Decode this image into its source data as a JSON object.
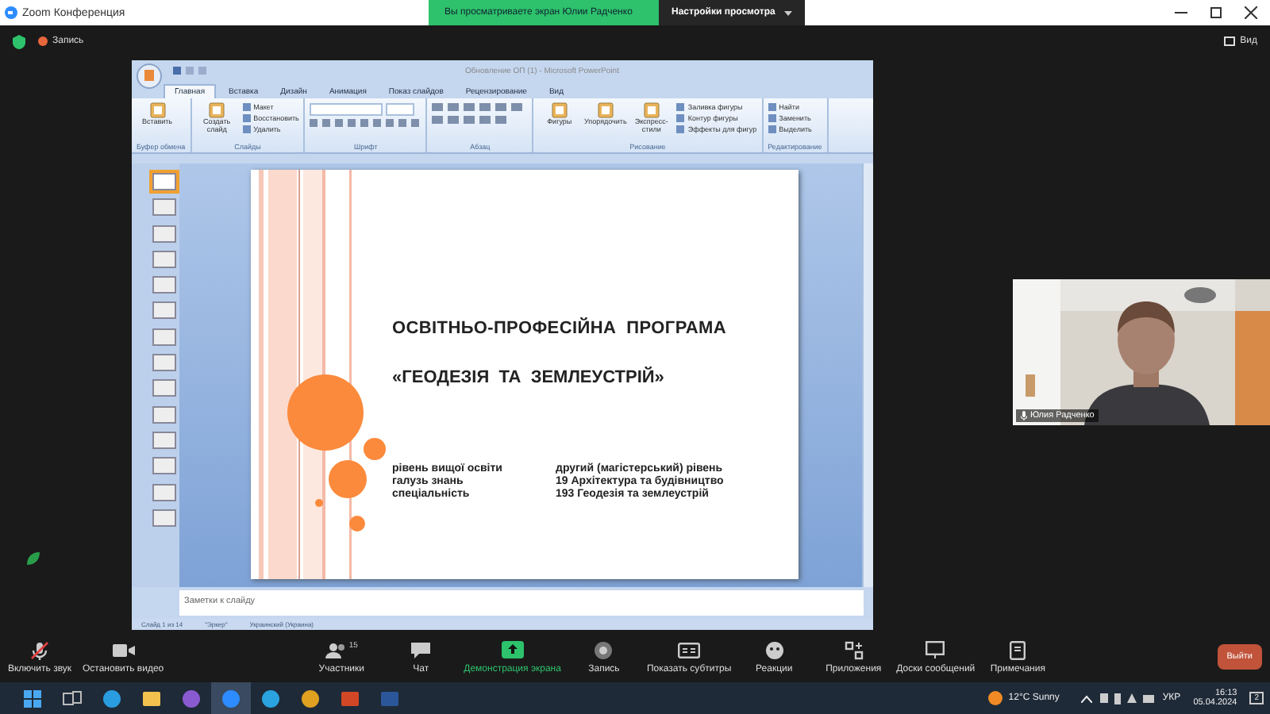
{
  "title_bar": {
    "app": "Zoom Конференция",
    "share_banner": "Вы просматриваете экран Юлии Радченко",
    "view_options": "Настройки просмотра"
  },
  "top_bar": {
    "recording": "Запись",
    "view": "Вид"
  },
  "powerpoint": {
    "title": "Обновление ОП (1) - Microsoft PowerPoint",
    "tabs": [
      {
        "label": "Главная",
        "selected": true
      },
      {
        "label": "Вставка",
        "selected": false
      },
      {
        "label": "Дизайн",
        "selected": false
      },
      {
        "label": "Анимация",
        "selected": false
      },
      {
        "label": "Показ слайдов",
        "selected": false
      },
      {
        "label": "Рецензирование",
        "selected": false
      },
      {
        "label": "Вид",
        "selected": false
      }
    ],
    "groups": [
      {
        "label": "Буфер обмена",
        "kind": "buttons",
        "buttons": [
          {
            "label": "Вставить",
            "kind": "large"
          }
        ]
      },
      {
        "label": "Слайды",
        "kind": "buttons",
        "buttons": [
          {
            "label": "Создать слайд",
            "kind": "large"
          },
          {
            "label": "Макет",
            "kind": "small"
          },
          {
            "label": "Восстановить",
            "kind": "small"
          },
          {
            "label": "Удалить",
            "kind": "small"
          }
        ]
      },
      {
        "label": "Шрифт",
        "kind": "font"
      },
      {
        "label": "Абзац",
        "kind": "paragraph"
      },
      {
        "label": "Рисование",
        "kind": "buttons",
        "buttons": [
          {
            "label": "Фигуры",
            "kind": "large"
          },
          {
            "label": "Упорядочить",
            "kind": "large"
          },
          {
            "label": "Экспресс-стили",
            "kind": "large"
          },
          {
            "label": "Заливка фигуры",
            "kind": "small"
          },
          {
            "label": "Контур фигуры",
            "kind": "small"
          },
          {
            "label": "Эффекты для фигур",
            "kind": "small"
          }
        ]
      },
      {
        "label": "Редактирование",
        "kind": "buttons",
        "buttons": [
          {
            "label": "Найти",
            "kind": "small"
          },
          {
            "label": "Заменить",
            "kind": "small"
          },
          {
            "label": "Выделить",
            "kind": "small"
          }
        ]
      }
    ],
    "slides": [
      {
        "selected": true
      },
      {
        "selected": false
      },
      {
        "selected": false
      },
      {
        "selected": false
      },
      {
        "selected": false
      },
      {
        "selected": false
      },
      {
        "selected": false
      },
      {
        "selected": false
      },
      {
        "selected": false
      },
      {
        "selected": false
      },
      {
        "selected": false
      },
      {
        "selected": false
      },
      {
        "selected": false
      },
      {
        "selected": false
      }
    ],
    "slide": {
      "title": "ОСВІТНЬО-ПРОФЕСІЙНА  ПРОГРАМА",
      "subtitle": "«ГЕОДЕЗІЯ  ТА  ЗЕМЛЕУСТРІЙ»",
      "details": [
        {
          "label": "рівень вищої освіти",
          "value": "другий (магістерський) рівень"
        },
        {
          "label": "галузь знань",
          "value": "19 Архітектура та будівництво"
        },
        {
          "label": "спеціальність",
          "value": "193 Геодезія та землеустрій"
        }
      ]
    },
    "notes_placeholder": "Заметки к слайду",
    "status": [
      "Слайд 1 из 14",
      "\"Эркер\"",
      "Украинский (Украина)"
    ]
  },
  "video": {
    "name": "Юлия Радченко"
  },
  "toolbar": [
    {
      "label": "Включить звук",
      "kind": "mic-off",
      "highlighted": false
    },
    {
      "label": "Остановить видео",
      "kind": "video",
      "highlighted": false
    },
    {
      "label": "Участники",
      "kind": "participants",
      "count": "15",
      "highlighted": false
    },
    {
      "label": "Чат",
      "kind": "chat",
      "highlighted": false
    },
    {
      "label": "Демонстрация экрана",
      "kind": "share",
      "highlighted": true
    },
    {
      "label": "Запись",
      "kind": "record",
      "highlighted": false
    },
    {
      "label": "Показать субтитры",
      "kind": "captions",
      "highlighted": false
    },
    {
      "label": "Реакции",
      "kind": "reactions",
      "highlighted": false
    },
    {
      "label": "Приложения",
      "kind": "apps",
      "highlighted": false
    },
    {
      "label": "Доски сообщений",
      "kind": "whiteboards",
      "highlighted": false
    },
    {
      "label": "Примечания",
      "kind": "notes",
      "highlighted": false
    }
  ],
  "leave": "Выйти",
  "taskbar": {
    "apps": [
      {
        "kind": "start",
        "active": false
      },
      {
        "kind": "taskview",
        "active": false
      },
      {
        "kind": "edge",
        "active": false
      },
      {
        "kind": "folder",
        "active": false
      },
      {
        "kind": "viber",
        "active": false
      },
      {
        "kind": "zoom",
        "active": true
      },
      {
        "kind": "telegram",
        "active": false
      },
      {
        "kind": "chrome",
        "active": false
      },
      {
        "kind": "powerpoint",
        "active": false
      },
      {
        "kind": "word",
        "active": false
      }
    ],
    "weather": "12°C  Sunny",
    "language": "УКР",
    "time": "16:13",
    "date": "05.04.2024",
    "notifications": "2"
  }
}
